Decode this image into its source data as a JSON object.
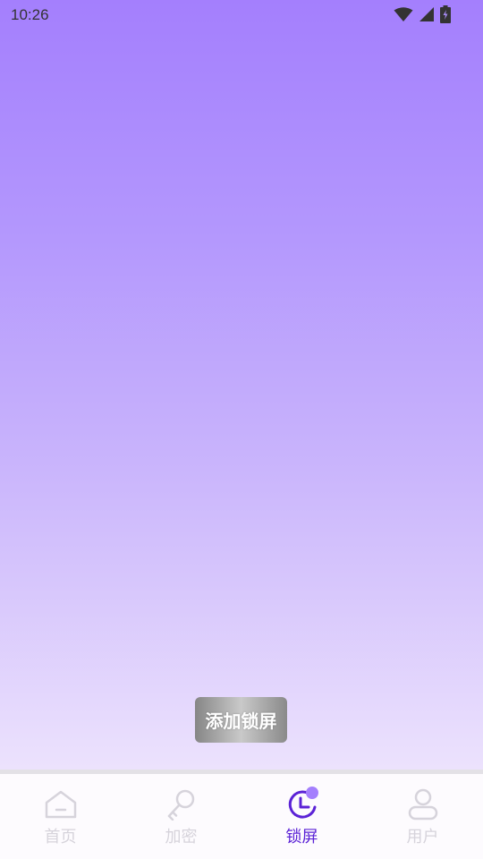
{
  "status_bar": {
    "time": "10:26",
    "icons": [
      "wifi-icon",
      "signal-icon",
      "battery-charging-icon"
    ]
  },
  "main": {
    "add_lock_button_label": "添加锁屏"
  },
  "tab_bar": {
    "tabs": [
      {
        "label": "首页",
        "icon": "home-icon",
        "active": false
      },
      {
        "label": "加密",
        "icon": "key-icon",
        "active": false
      },
      {
        "label": "锁屏",
        "icon": "lock-screen-icon",
        "active": true
      },
      {
        "label": "用户",
        "icon": "user-icon",
        "active": false
      }
    ]
  },
  "colors": {
    "gradient_top": "#a47ffd",
    "gradient_bottom": "#ece2fd",
    "active_tab": "#5b22d6",
    "inactive_tab": "#d6d3db"
  }
}
